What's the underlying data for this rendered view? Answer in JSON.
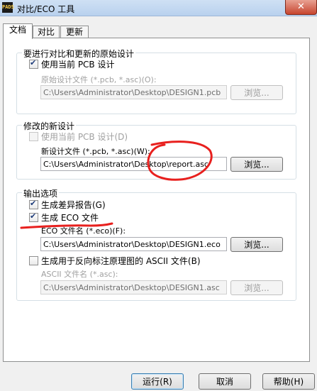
{
  "window": {
    "title": "对比/ECO 工具",
    "icon": "app-icon",
    "close_glyph": "✕"
  },
  "tabs": [
    "文档",
    "对比",
    "更新"
  ],
  "original": {
    "title": "要进行对比和更新的原始设计",
    "use_current_label": "使用当前 PCB 设计",
    "use_current_checked": true,
    "file_label": "原始设计文件 (*.pcb, *.asc)(O):",
    "file_value": "C:\\Users\\Administrator\\Desktop\\DESIGN1.pcb",
    "browse_label": "浏览..."
  },
  "modified": {
    "title": "修改的新设计",
    "use_current_label": "使用当前 PCB 设计(D)",
    "use_current_checked": false,
    "file_label": "新设计文件 (*.pcb, *.asc)(W):",
    "file_value": "C:\\Users\\Administrator\\Desktop\\report.asc",
    "browse_label": "浏览..."
  },
  "output": {
    "title": "输出选项",
    "diff_report_label": "生成差异报告(G)",
    "diff_report_checked": true,
    "eco_file_label": "生成 ECO 文件",
    "eco_file_checked": true,
    "eco_name_label": "ECO 文件名 (*.eco)(F):",
    "eco_name_value": "C:\\Users\\Administrator\\Desktop\\DESIGN1.eco",
    "eco_browse_label": "浏览...",
    "ascii_label": "生成用于反向标注原理图的 ASCII 文件(B)",
    "ascii_checked": false,
    "ascii_name_label": "ASCII 文件名 (*.asc):",
    "ascii_name_value": "C:\\Users\\Administrator\\Desktop\\DESIGN1.asc",
    "ascii_browse_label": "浏览..."
  },
  "buttons": {
    "run": "运行(R)",
    "cancel": "取消",
    "help": "帮助(H)"
  },
  "colors": {
    "annotation": "#e8201e"
  }
}
